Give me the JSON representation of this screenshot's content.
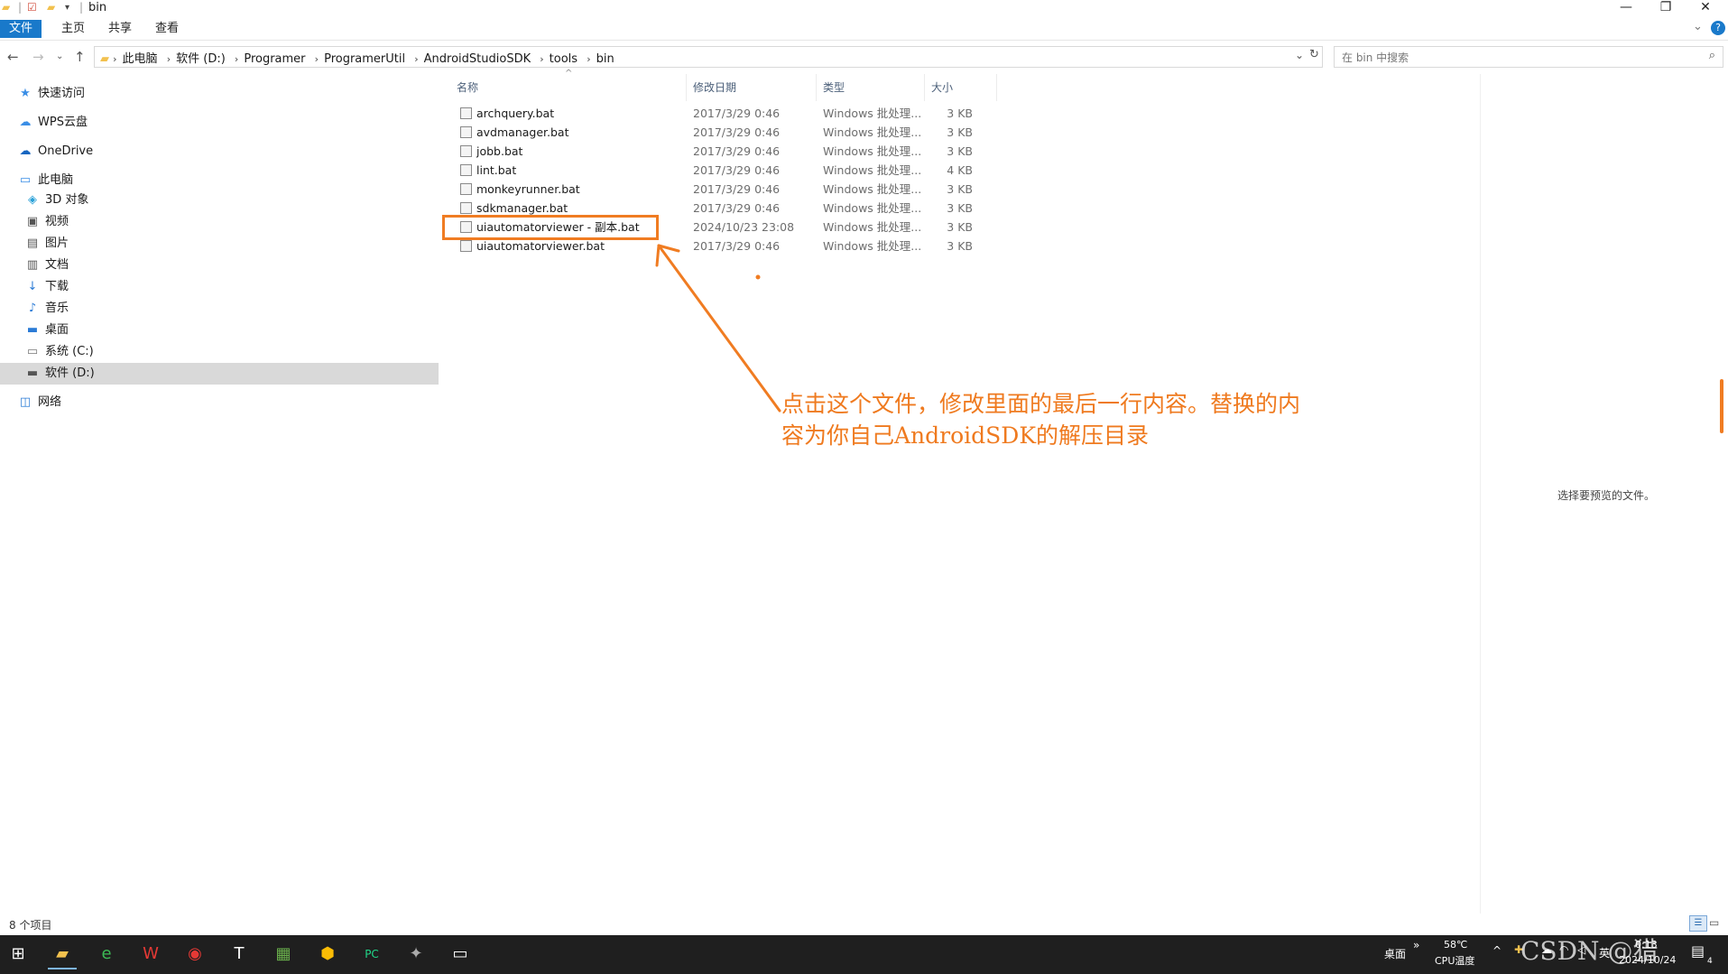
{
  "window": {
    "title": "bin",
    "minimize": "—",
    "restore": "❐",
    "close": "✕"
  },
  "ribbon": {
    "tabs": [
      {
        "label": "文件",
        "active": true
      },
      {
        "label": "主页"
      },
      {
        "label": "共享"
      },
      {
        "label": "查看"
      }
    ],
    "expand": "⌄",
    "help": "?"
  },
  "address": {
    "crumbs": [
      "此电脑",
      "软件 (D:)",
      "Programer",
      "ProgramerUtil",
      "AndroidStudioSDK",
      "tools",
      "bin"
    ],
    "dropdown": "⌄",
    "refresh": "↻"
  },
  "search": {
    "placeholder": "在 bin 中搜索"
  },
  "nav": {
    "items": [
      {
        "label": "快速访问",
        "icon": "★",
        "color": "#3a8ee6"
      },
      {
        "label": "WPS云盘",
        "icon": "☁",
        "color": "#3a8ee6"
      },
      {
        "label": "OneDrive",
        "icon": "☁",
        "color": "#1565c0"
      },
      {
        "label": "此电脑",
        "icon": "▭",
        "color": "#3a8ee6"
      },
      {
        "label": "3D 对象",
        "icon": "◈",
        "color": "#2aa1d8"
      },
      {
        "label": "视频",
        "icon": "▣",
        "color": "#555555"
      },
      {
        "label": "图片",
        "icon": "▤",
        "color": "#555555"
      },
      {
        "label": "文档",
        "icon": "▥",
        "color": "#555555"
      },
      {
        "label": "下载",
        "icon": "↓",
        "color": "#2b7bd6"
      },
      {
        "label": "音乐",
        "icon": "♪",
        "color": "#2b7bd6"
      },
      {
        "label": "桌面",
        "icon": "▬",
        "color": "#2b7bd6"
      },
      {
        "label": "系统 (C:)",
        "icon": "▭",
        "color": "#777777"
      },
      {
        "label": "软件 (D:)",
        "icon": "▬",
        "color": "#555555",
        "selected": true
      },
      {
        "label": "网络",
        "icon": "◫",
        "color": "#2b7bd6"
      }
    ]
  },
  "filelist": {
    "columns": {
      "name": "名称",
      "date": "修改日期",
      "type": "类型",
      "size": "大小"
    },
    "sort_arrow": "^",
    "rows": [
      {
        "name": "archquery.bat",
        "date": "2017/3/29 0:46",
        "type": "Windows 批处理...",
        "size": "3 KB"
      },
      {
        "name": "avdmanager.bat",
        "date": "2017/3/29 0:46",
        "type": "Windows 批处理...",
        "size": "3 KB"
      },
      {
        "name": "jobb.bat",
        "date": "2017/3/29 0:46",
        "type": "Windows 批处理...",
        "size": "3 KB"
      },
      {
        "name": "lint.bat",
        "date": "2017/3/29 0:46",
        "type": "Windows 批处理...",
        "size": "4 KB"
      },
      {
        "name": "monkeyrunner.bat",
        "date": "2017/3/29 0:46",
        "type": "Windows 批处理...",
        "size": "3 KB"
      },
      {
        "name": "sdkmanager.bat",
        "date": "2017/3/29 0:46",
        "type": "Windows 批处理...",
        "size": "3 KB"
      },
      {
        "name": "uiautomatorviewer - 副本.bat",
        "date": "2024/10/23 23:08",
        "type": "Windows 批处理...",
        "size": "3 KB"
      },
      {
        "name": "uiautomatorviewer.bat",
        "date": "2017/3/29 0:46",
        "type": "Windows 批处理...",
        "size": "3 KB"
      }
    ]
  },
  "annotation": {
    "line1": "点击这个文件，修改里面的最后一行内容。替换的内",
    "line2": "容为你自己AndroidSDK的解压目录",
    "color": "#ef7a1f"
  },
  "preview": {
    "text": "选择要预览的文件。"
  },
  "status": {
    "count": "8 个项目"
  },
  "taskbar": {
    "apps": [
      {
        "icon": "⊞",
        "name": "start"
      },
      {
        "icon": "▰",
        "name": "explorer",
        "color": "#f2c14e",
        "active": true
      },
      {
        "icon": "e",
        "name": "browser",
        "color": "#3cba54"
      },
      {
        "icon": "W",
        "name": "wps",
        "color": "#e53935"
      },
      {
        "icon": "◉",
        "name": "music",
        "color": "#e53935"
      },
      {
        "icon": "T",
        "name": "typora",
        "color": "#ffffff"
      },
      {
        "icon": "▦",
        "name": "notepad",
        "color": "#6ab04c"
      },
      {
        "icon": "⬢",
        "name": "chrome",
        "color": "#fbbc05"
      },
      {
        "icon": "PC",
        "name": "pycharm",
        "color": "#21d789"
      },
      {
        "icon": "✦",
        "name": "paint",
        "color": "#aaaaaa"
      },
      {
        "icon": "▭",
        "name": "terminal",
        "color": "#ffffff"
      }
    ],
    "desktop_label": "桌面",
    "chevron": "»",
    "temp": "58℃",
    "temp_label": "CPU温度",
    "lang": "英",
    "time": "0:13",
    "date": "2024/10/24",
    "notif_count": "4",
    "watermark": "CSDN @猎"
  }
}
